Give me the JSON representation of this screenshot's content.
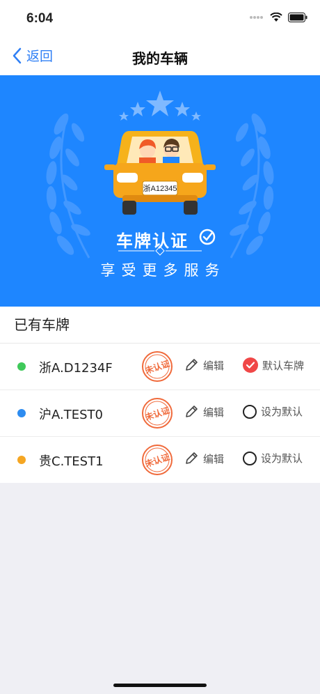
{
  "status_bar": {
    "time": "6:04"
  },
  "nav": {
    "back_label": "返回",
    "title": "我的车辆"
  },
  "banner": {
    "plate_text": "浙A12345",
    "title": "车牌认证",
    "subtitle": "享受更多服务"
  },
  "section": {
    "header": "已有车牌",
    "plates": [
      {
        "dot_color": "#3fc95a",
        "number": "浙A.D1234F",
        "stamp": "未认证",
        "edit_label": "编辑",
        "default_label": "默认车牌",
        "is_default": true
      },
      {
        "dot_color": "#2d8cf0",
        "number": "沪A.TEST0",
        "stamp": "未认证",
        "edit_label": "编辑",
        "default_label": "设为默认",
        "is_default": false
      },
      {
        "dot_color": "#f5a623",
        "number": "贵C.TEST1",
        "stamp": "未认证",
        "edit_label": "编辑",
        "default_label": "设为默认",
        "is_default": false
      }
    ]
  },
  "colors": {
    "accent": "#2f7ff5",
    "banner": "#1e86ff",
    "stamp": "#f06a3b",
    "check": "#f04747"
  }
}
